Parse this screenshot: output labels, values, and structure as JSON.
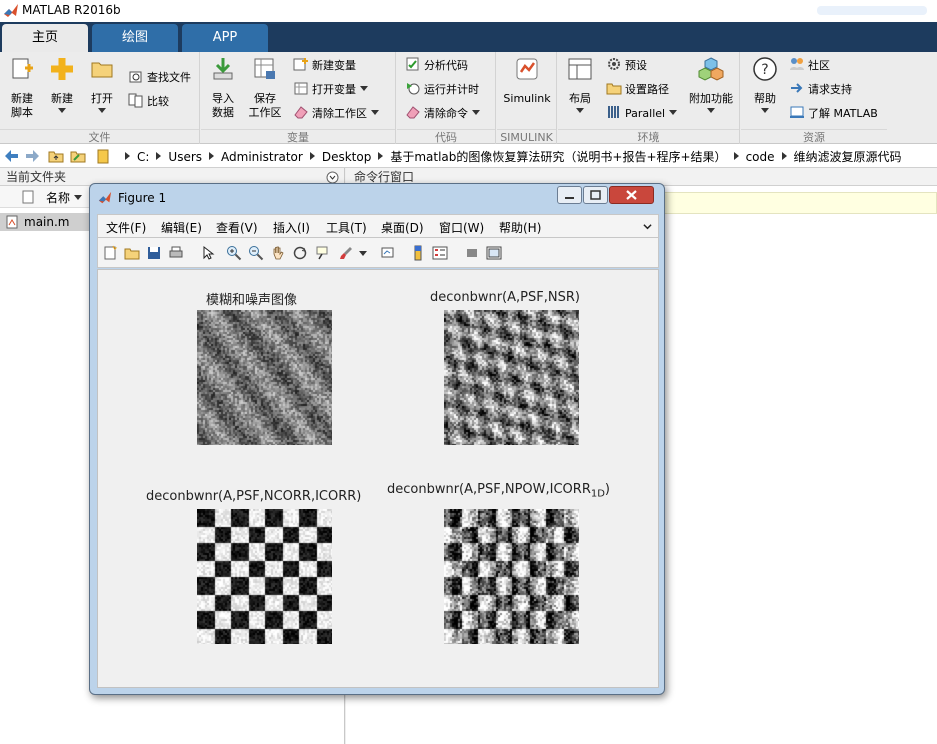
{
  "app": {
    "title": "MATLAB R2016b"
  },
  "tabs": [
    "主页",
    "绘图",
    "APP"
  ],
  "ribbon": {
    "file_group": {
      "label": "文件",
      "new_script": "新建\n脚本",
      "new": "新建",
      "open": "打开",
      "find_files": "查找文件",
      "compare": "比较"
    },
    "variable_group": {
      "label": "变量",
      "import": "导入\n数据",
      "save_workspace": "保存\n工作区",
      "new_variable": "新建变量",
      "open_variable": "打开变量",
      "clear_workspace": "清除工作区"
    },
    "code_group": {
      "label": "代码",
      "analyze": "分析代码",
      "run_time": "运行并计时",
      "clear_commands": "清除命令"
    },
    "simulink_group": {
      "label": "SIMULINK",
      "simulink": "Simulink"
    },
    "env_group": {
      "label": "环境",
      "layout": "布局",
      "prefs": "预设",
      "set_path": "设置路径",
      "parallel": "Parallel",
      "addons": "附加功能"
    },
    "resources_group": {
      "label": "资源",
      "help": "帮助",
      "community": "社区",
      "support": "请求支持",
      "learn": "了解 MATLAB"
    }
  },
  "breadcrumb": [
    "C:",
    "Users",
    "Administrator",
    "Desktop",
    "基于matlab的图像恢复算法研究（说明书+报告+程序+结果）",
    "code",
    "维纳滤波复原源代码"
  ],
  "current_folder": {
    "title": "当前文件夹",
    "name_col": "名称",
    "file": "main.m"
  },
  "command_window": {
    "title": "命令行窗口"
  },
  "figure": {
    "title": "Figure 1",
    "menu": [
      "文件(F)",
      "编辑(E)",
      "查看(V)",
      "插入(I)",
      "工具(T)",
      "桌面(D)",
      "窗口(W)",
      "帮助(H)"
    ],
    "plots": [
      {
        "title": "模糊和噪声图像"
      },
      {
        "title": "deconbwnr(A,PSF,NSR)"
      },
      {
        "title": "deconbwnr(A,PSF,NCORR,ICORR)"
      },
      {
        "title": "deconbwnr(A,PSF,NPOW,ICORR",
        "sub": "1D",
        "suffix": ")"
      }
    ]
  },
  "colors": {
    "tab_strip": "#1d3b5e",
    "tab_inactive": "#2f6ea8",
    "ribbon": "#ececec",
    "figure_frame": "#bcd3ea"
  }
}
